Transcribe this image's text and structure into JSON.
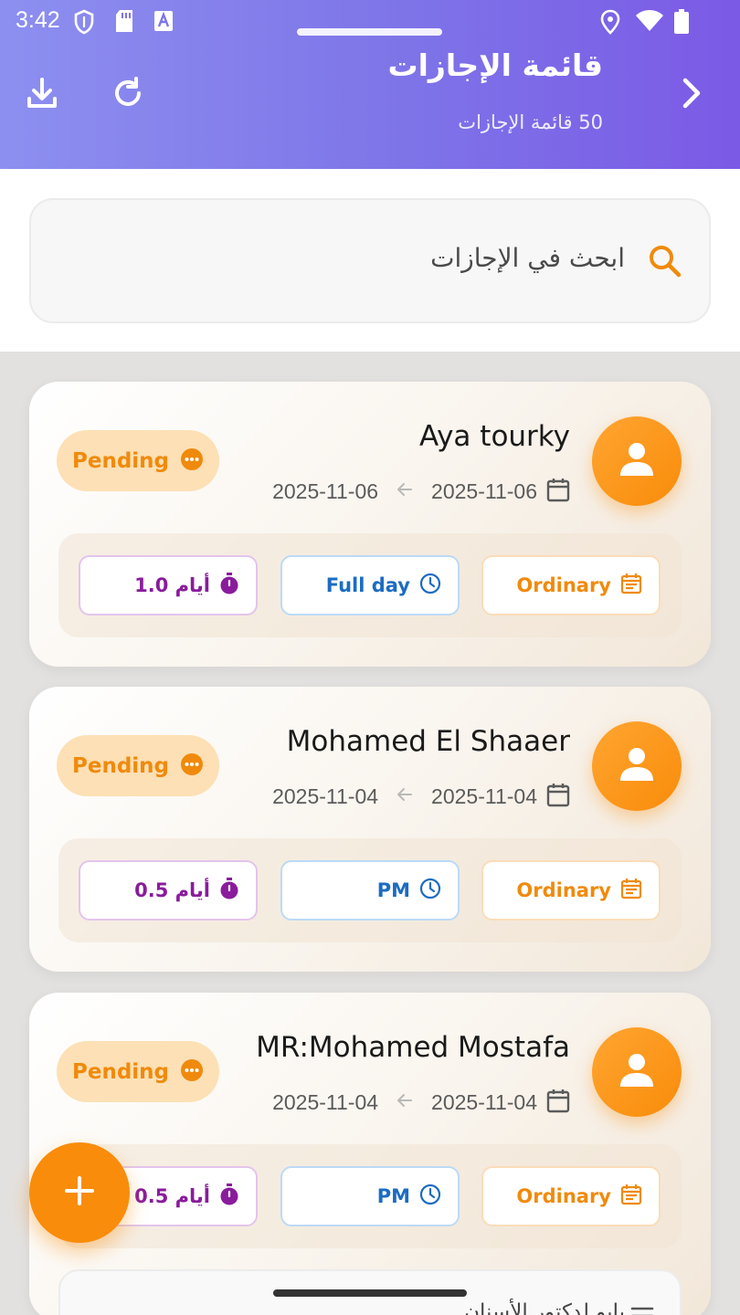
{
  "status_bar": {
    "time": "3:42"
  },
  "header": {
    "title": "قائمة الإجازات",
    "subtitle": "50 قائمة الإجازات"
  },
  "search": {
    "placeholder": "ابحث في الإجازات"
  },
  "cards": [
    {
      "name": "Aya tourky",
      "date_from": "2025-11-06",
      "date_to": "2025-11-06",
      "status": "Pending",
      "type": "Ordinary",
      "duration": "Full day",
      "days": "1.0 أيام"
    },
    {
      "name": "Mohamed El Shaaer",
      "date_from": "2025-11-04",
      "date_to": "2025-11-04",
      "status": "Pending",
      "type": "Ordinary",
      "duration": "PM",
      "days": "0.5 أيام"
    },
    {
      "name": "MR:Mohamed Mostafa",
      "date_from": "2025-11-04",
      "date_to": "2025-11-04",
      "status": "Pending",
      "type": "Ordinary",
      "duration": "PM",
      "days": "0.5 أيام"
    }
  ],
  "peek_card": {
    "text": "بابو لدكتور الأسنان"
  },
  "colors": {
    "accent": "#f98c0a",
    "header_start": "#8d8ff0",
    "header_end": "#7b5ae6",
    "status_pending": "#f08a0c",
    "duration_blue": "#1c6cc2",
    "days_purple": "#8a1c9c"
  },
  "icons": {
    "header_left": [
      "download-icon",
      "refresh-icon"
    ],
    "header_right": "chevron-right-icon",
    "search": "search-icon",
    "avatar": "person-icon",
    "date": "calendar-icon",
    "date_arrow": "arrow-left-icon",
    "status": "more-horizontal-circle-icon",
    "type": "event-note-icon",
    "duration": "clock-icon",
    "days": "timer-icon",
    "fab": "plus-icon"
  }
}
